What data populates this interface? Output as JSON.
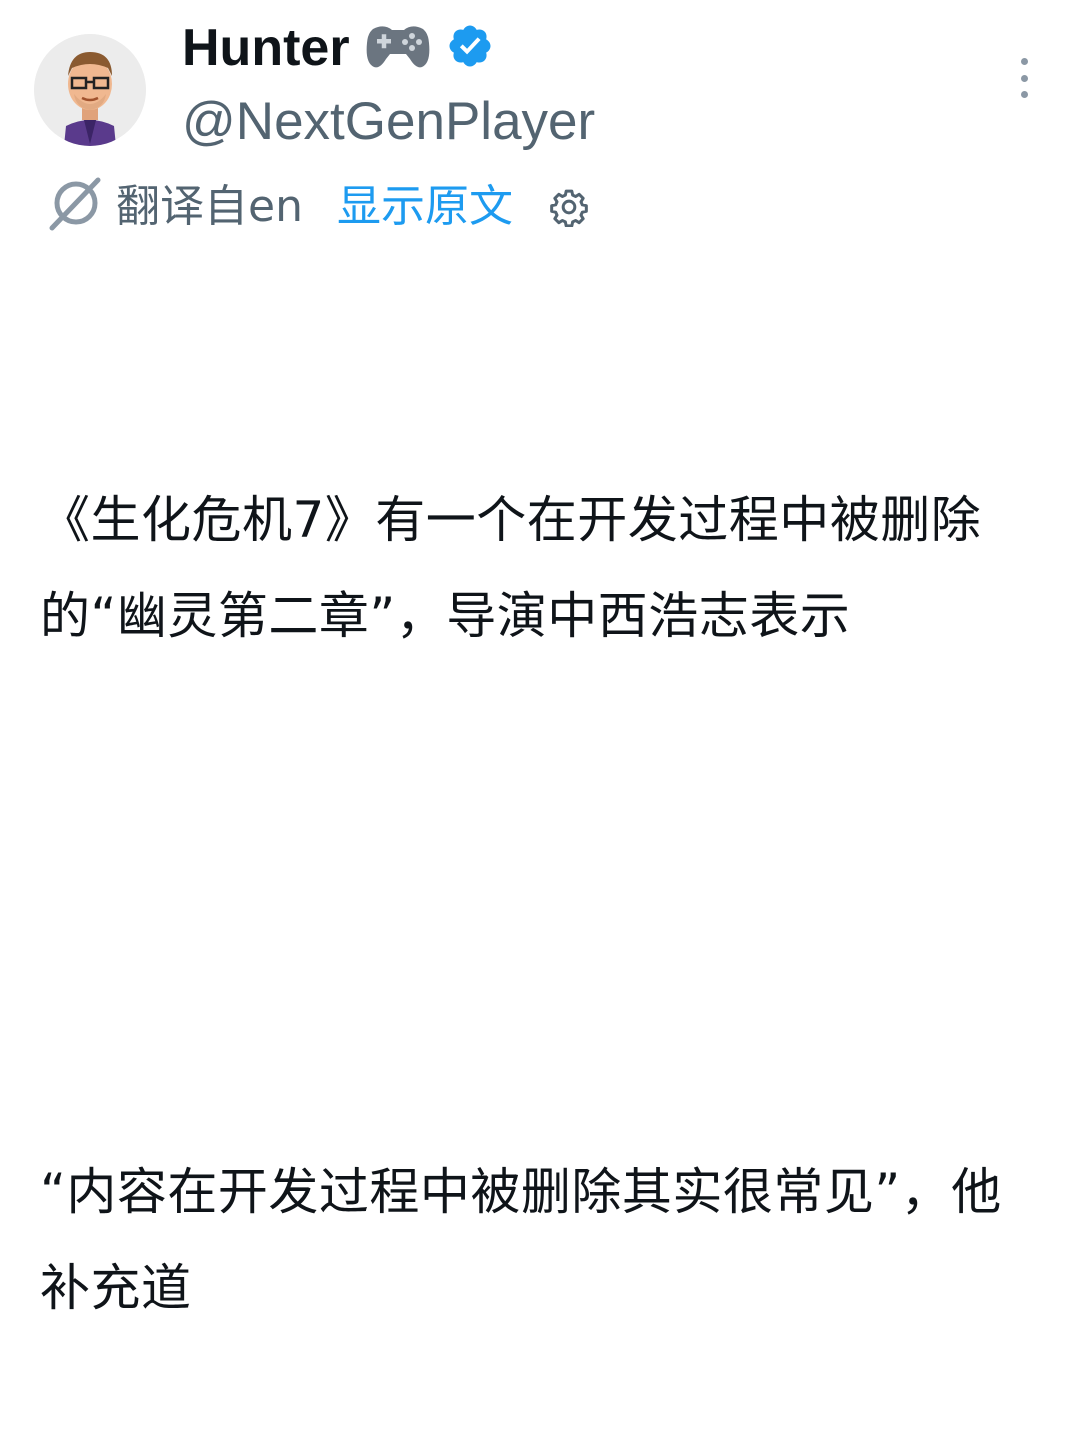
{
  "author": {
    "display_name": "Hunter",
    "handle": "@NextGenPlayer",
    "name_emoji": "gamepad-icon",
    "verified_badge": "verified-badge-icon"
  },
  "translation": {
    "icon": "translate-icon",
    "label": "翻译自en",
    "show_original": "显示原文",
    "settings_icon": "gear-icon"
  },
  "tweet": {
    "paragraph_1": "《生化危机7》有一个在开发过程中被删除的“幽灵第二章”，导演中西浩志表示",
    "paragraph_2": "“内容在开发过程中被删除其实很常见”，他补充道"
  },
  "colors": {
    "accent": "#1d9bf0",
    "secondary_text": "#536471",
    "primary_text": "#0f1419"
  }
}
